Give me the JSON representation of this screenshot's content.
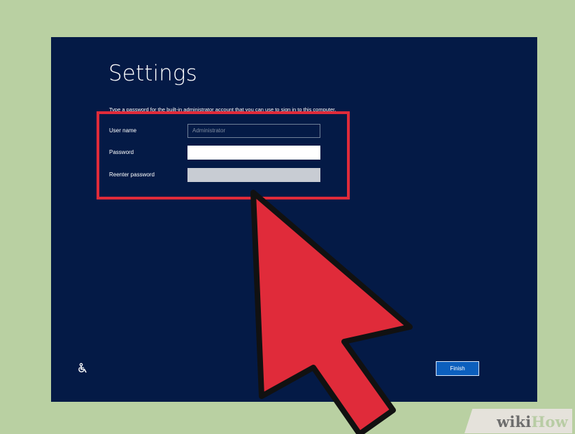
{
  "screen": {
    "title": "Settings",
    "instruction": "Type a password for the built-in administrator account that you can use to sign in to this computer."
  },
  "form": {
    "user_name": {
      "label": "User name",
      "value": "Administrator"
    },
    "password": {
      "label": "Password",
      "value": ""
    },
    "reenter_password": {
      "label": "Reenter password",
      "value": ""
    }
  },
  "footer": {
    "accessibility_icon": "accessibility-icon",
    "finish_label": "Finish"
  },
  "overlay": {
    "highlight_color": "#e02b3a",
    "cursor_color": "#e02b3a",
    "cursor_icon": "cursor-arrow-icon"
  },
  "watermark": {
    "part1": "wiki",
    "part2": "How"
  },
  "colors": {
    "background": "#b9d0a2",
    "screen": "#041a46",
    "button": "#0c5fbd"
  }
}
